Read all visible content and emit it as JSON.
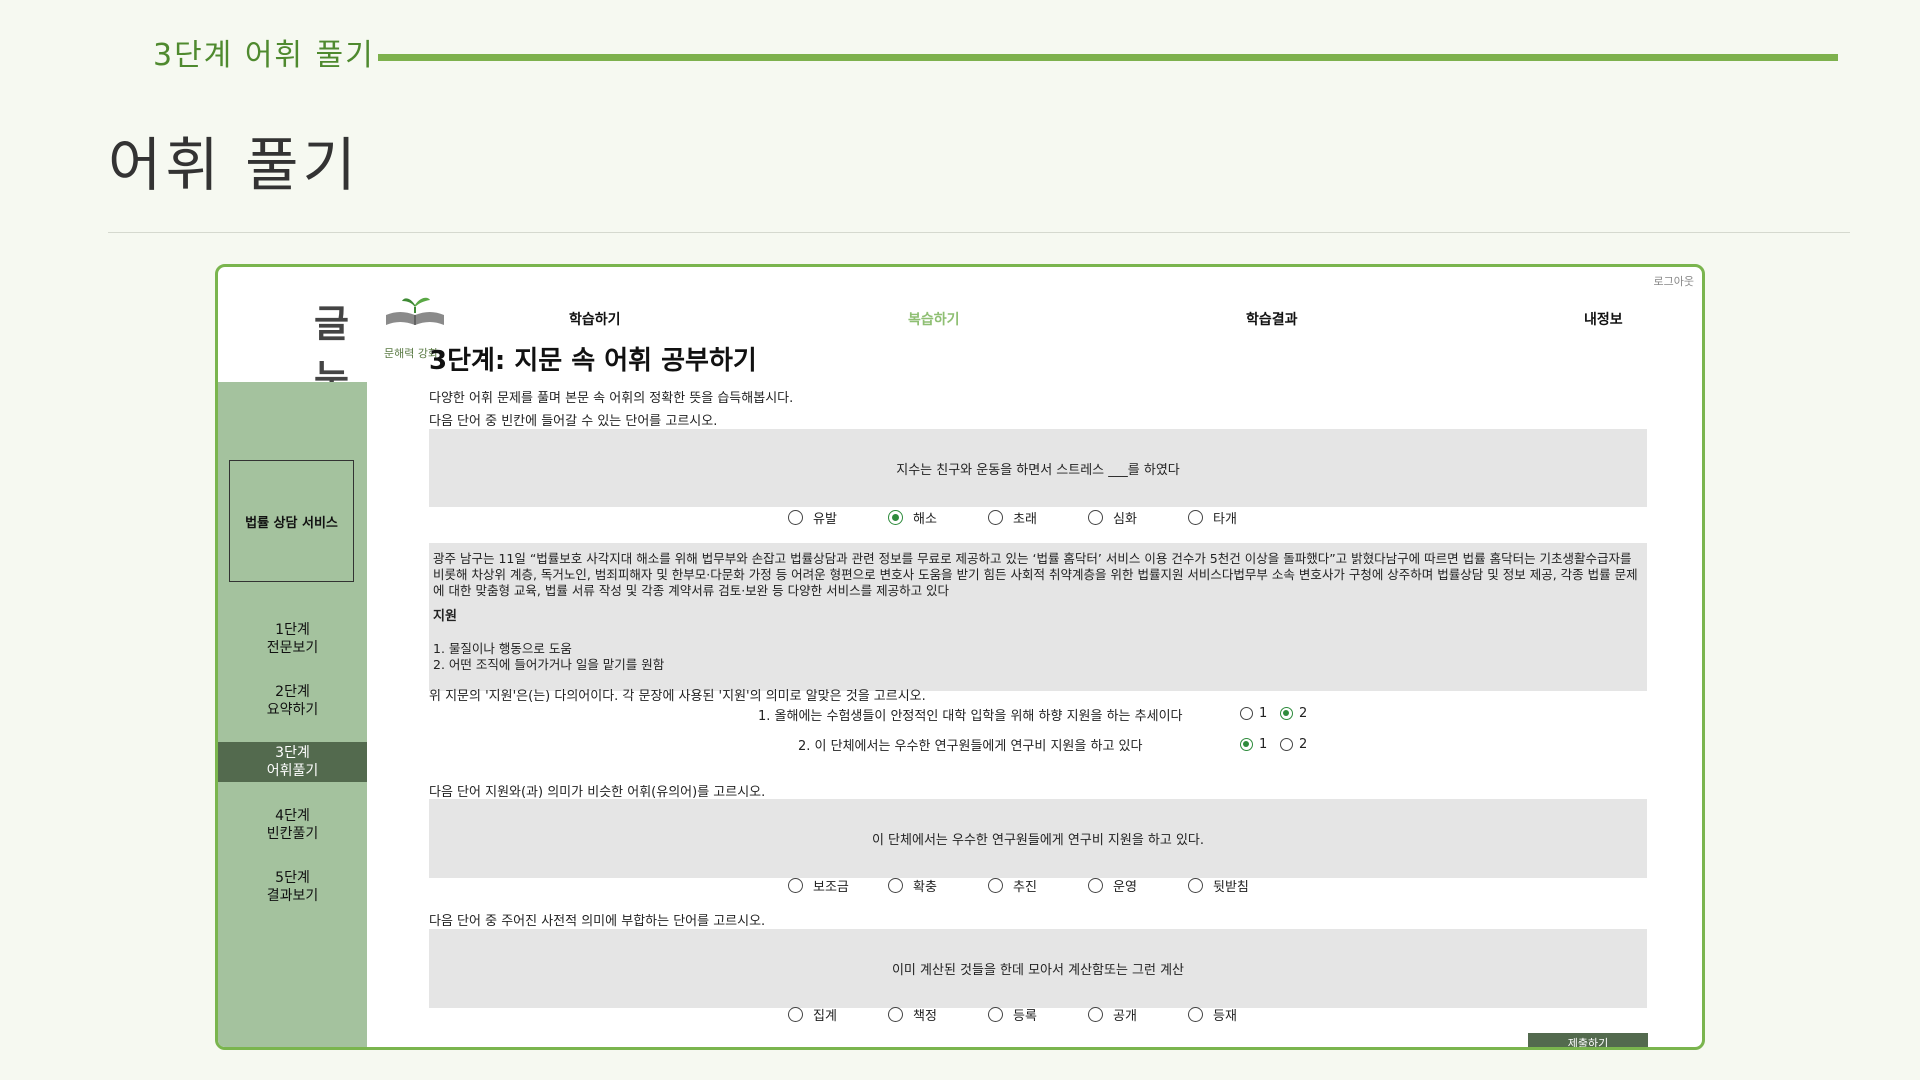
{
  "slide": {
    "step_label": "3단계 어휘 풀기",
    "title": "어휘 풀기"
  },
  "app": {
    "logout": "로그아웃",
    "logo_main": "글눈",
    "logo_sub": "문해력 강화",
    "nav": [
      "학습하기",
      "복습하기",
      "학습결과",
      "내정보"
    ],
    "page_heading": "3단계: 지문 속 어휘 공부하기",
    "sidebar": {
      "service": "법률 상담 서비스",
      "steps": [
        {
          "num": "1단계",
          "name": "전문보기"
        },
        {
          "num": "2단계",
          "name": "요약하기"
        },
        {
          "num": "3단계",
          "name": "어휘풀기"
        },
        {
          "num": "4단계",
          "name": "빈칸풀기"
        },
        {
          "num": "5단계",
          "name": "결과보기"
        }
      ]
    },
    "intro": "다양한 어휘 문제를 풀며 본문 속 어휘의 정확한 뜻을 습득해봅시다.",
    "q1": {
      "prompt": "다음 단어 중 빈칸에 들어갈 수 있는 단어를 고르시오.",
      "sentence": "지수는 친구와 운동을 하면서 스트레스 ___를 하였다",
      "options": [
        "유발",
        "해소",
        "초래",
        "심화",
        "타개"
      ]
    },
    "passage": {
      "text": "광주 남구는 11일 “법률보호 사각지대 해소를 위해 법무부와 손잡고 법률상담과 관련 정보를 무료로 제공하고 있는 ‘법률 홈닥터’ 서비스 이용 건수가 5천건 이상을 돌파했다”고 밝혔다남구에 따르면 법률 홈닥터는 기초생활수급자를 비롯해 차상위 계층, 독거노인, 범죄피해자 및 한부모·다문화 가정 등 어려운 형편으로 변호사 도움을 받기 힘든 사회적 취약계층을 위한 법률지원 서비스다법무부 소속 변호사가 구청에 상주하며 법률상담 및 정보 제공, 각종 법률 문제에 대한 맞춤형 교육, 법률 서류 작성 및 각종 계약서류 검토·보완 등 다양한 서비스를 제공하고 있다",
      "word": "지원",
      "def1": "1. 물질이나 행동으로 도움",
      "def2": "2. 어떤 조직에 들어가거나 일을 맡기를 원함"
    },
    "q2": {
      "prompt": "위 지문의 '지원'은(는) 다의어이다. 각 문장에 사용된 '지원'의 의미로 알맞은 것을 고르시오.",
      "items": [
        {
          "sentence": "1. 올해에는 수험생들이 안정적인 대학 입학을 위해 하향 지원을 하는 추세이다",
          "opt1": "1",
          "opt2": "2",
          "selected": 2
        },
        {
          "sentence": "2. 이 단체에서는 우수한 연구원들에게 연구비 지원을 하고 있다",
          "opt1": "1",
          "opt2": "2",
          "selected": 1
        }
      ]
    },
    "q3": {
      "prompt": "다음 단어 지원와(과) 의미가 비슷한 어휘(유의어)를 고르시오.",
      "sentence": "이 단체에서는 우수한 연구원들에게 연구비 지원을 하고 있다.",
      "options": [
        "보조금",
        "확충",
        "추진",
        "운영",
        "뒷받침"
      ]
    },
    "q4": {
      "prompt": "다음 단어 중 주어진 사전적 의미에 부합하는 단어를 고르시오.",
      "sentence": "이미 계산된 것들을 한데 모아서 계산함또는 그런 계산",
      "options": [
        "집계",
        "책정",
        "등록",
        "공개",
        "등재"
      ]
    },
    "submit": "제출하기"
  }
}
